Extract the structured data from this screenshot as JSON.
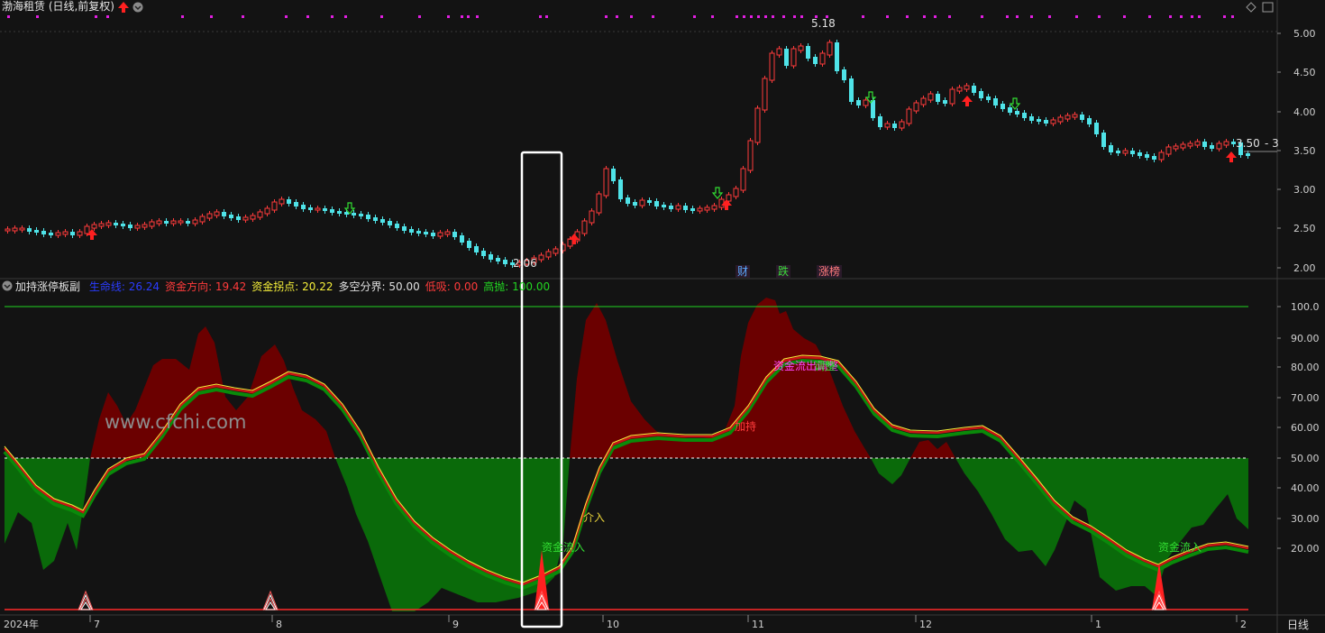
{
  "header": {
    "title": "渤海租赁 (日线,前复权)",
    "diamond_icon": "diamond-icon",
    "window_icon": "window-icon"
  },
  "indicator": {
    "name": "加持涨停板副",
    "items": [
      {
        "label": "生命线",
        "value": "26.24",
        "color": "#2a3cff"
      },
      {
        "label": "资金方向",
        "value": "19.42",
        "color": "#ff3b3b"
      },
      {
        "label": "资金拐点",
        "value": "20.22",
        "color": "#f6f03a"
      },
      {
        "label": "多空分界",
        "value": "50.00",
        "color": "#e0e0e0"
      },
      {
        "label": "低吸",
        "value": "0.00",
        "color": "#ff3b3b"
      },
      {
        "label": "高抛",
        "value": "100.00",
        "color": "#22d622"
      }
    ]
  },
  "price_axis": [
    "5.00",
    "4.50",
    "4.00",
    "3.50",
    "3.00",
    "2.50",
    "2.00"
  ],
  "indicator_axis": [
    "100.0",
    "90.00",
    "80.00",
    "70.00",
    "60.00",
    "50.00",
    "40.00",
    "30.00",
    "20.00"
  ],
  "time_axis": [
    {
      "label": "2024年"
    },
    {
      "label": "7"
    },
    {
      "label": "8"
    },
    {
      "label": "9"
    },
    {
      "label": "10"
    },
    {
      "label": "11"
    },
    {
      "label": "12"
    },
    {
      "label": "1"
    },
    {
      "label": "2"
    }
  ],
  "period_label": "日线",
  "price_annotations": {
    "high": "5.18",
    "low": "2.06",
    "last": "3.50",
    "last_suffix": "- 3"
  },
  "event_tags": [
    {
      "label": "财",
      "color": "#5aa8ff"
    },
    {
      "label": "跌",
      "color": "#3cdc3c"
    },
    {
      "label": "涨榜",
      "color": "#ff7b7b"
    }
  ],
  "signals": {
    "fund_inflow": "资金流入",
    "enter": "介入",
    "hold": "加持",
    "fund_outflow_adjust": "资金流出调整",
    "adjust": "调整"
  },
  "watermark": "www.cfchi.com",
  "colors": {
    "up": "#ff3b3b",
    "down": "#4fe3e8",
    "bull_area": "#6b0000",
    "bear_area": "#0a6a0a"
  }
}
